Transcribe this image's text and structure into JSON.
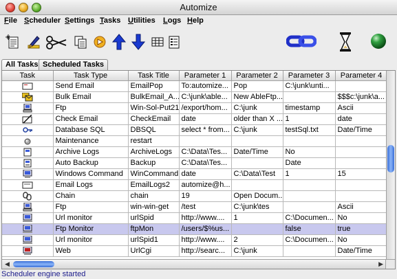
{
  "window": {
    "title": "Automize"
  },
  "menu": [
    {
      "label": "File",
      "u": "F",
      "rest": "ile"
    },
    {
      "label": "Scheduler",
      "u": "S",
      "rest": "cheduler"
    },
    {
      "label": "Settings",
      "u": "S",
      "rest": "ettings"
    },
    {
      "label": "Tasks",
      "u": "T",
      "rest": "asks"
    },
    {
      "label": "Utilities",
      "u": "U",
      "rest": "tilities"
    },
    {
      "label": "Logs",
      "u": "L",
      "rest": "ogs"
    },
    {
      "label": "Help",
      "u": "H",
      "rest": "elp"
    }
  ],
  "toolbar": [
    "new-task-icon",
    "edit-icon",
    "cut-icon",
    "copy-icon",
    "run-icon",
    "move-up-icon",
    "move-down-icon",
    "table-view-icon",
    "list-view-icon",
    "chain-link-icon",
    "hourglass-icon",
    "status-orb-icon"
  ],
  "tabs": [
    {
      "label": "All Tasks",
      "active": true
    },
    {
      "label": "Scheduled Tasks",
      "active": false
    }
  ],
  "table": {
    "columns": [
      "Task",
      "Task Type",
      "Task Title",
      "Parameter 1",
      "Parameter 2",
      "Parameter 3",
      "Parameter 4"
    ],
    "rows": [
      {
        "icon": "email-icon",
        "type": "Send Email",
        "title": "EmailPop",
        "p1": "To:automize...",
        "p2": "Pop",
        "p3": "C:\\junk\\unti...",
        "p4": ""
      },
      {
        "icon": "bulk-email-icon",
        "type": "Bulk Email",
        "title": "BulkEmail_A...",
        "p1": "C:\\junk\\able...",
        "p2": "New AbleFtp...",
        "p3": "",
        "p4": "$$$c:\\junk\\a..."
      },
      {
        "icon": "ftp-icon",
        "type": "Ftp",
        "title": "Win-Sol-Put21",
        "p1": "/export/hom...",
        "p2": "C:\\junk",
        "p3": "timestamp",
        "p4": "Ascii"
      },
      {
        "icon": "check-email-icon",
        "type": "Check Email",
        "title": "CheckEmail",
        "p1": "date",
        "p2": "older than X ...",
        "p3": "1",
        "p4": "date"
      },
      {
        "icon": "database-key-icon",
        "type": "Database SQL",
        "title": "DBSQL",
        "p1": "select * from...",
        "p2": "C:\\junk",
        "p3": "testSql.txt",
        "p4": "Date/Time"
      },
      {
        "icon": "maintenance-icon",
        "type": "Maintenance",
        "title": "restart",
        "p1": "",
        "p2": "",
        "p3": "",
        "p4": ""
      },
      {
        "icon": "archive-icon",
        "type": "Archive Logs",
        "title": "ArchiveLogs",
        "p1": "C:\\Data\\Tes...",
        "p2": "Date/Time",
        "p3": "No",
        "p4": ""
      },
      {
        "icon": "backup-icon",
        "type": "Auto Backup",
        "title": "Backup",
        "p1": "C:\\Data\\Tes...",
        "p2": "",
        "p3": "Date",
        "p4": ""
      },
      {
        "icon": "windows-command-icon",
        "type": "Windows Command",
        "title": "WinCommand",
        "p1": "date",
        "p2": "C:\\Data\\Test",
        "p3": "1",
        "p4": "15"
      },
      {
        "icon": "email-logs-icon",
        "type": "Email Logs",
        "title": "EmailLogs2",
        "p1": "automize@h...",
        "p2": "",
        "p3": "",
        "p4": ""
      },
      {
        "icon": "chain-icon",
        "type": "Chain",
        "title": "chain",
        "p1": "19",
        "p2": "Open Docum...",
        "p3": "",
        "p4": ""
      },
      {
        "icon": "ftp-icon",
        "type": "Ftp",
        "title": "win-win-get",
        "p1": "/test",
        "p2": "C:\\junk\\tes",
        "p3": "",
        "p4": "Ascii"
      },
      {
        "icon": "url-monitor-icon",
        "type": "Url monitor",
        "title": "urlSpid",
        "p1": "http://www....",
        "p2": "1",
        "p3": "C:\\Documen...",
        "p4": "No"
      },
      {
        "icon": "ftp-monitor-icon",
        "type": "Ftp Monitor",
        "title": "ftpMon",
        "p1": "/users/$%us...",
        "p2": "",
        "p3": "false",
        "p4": "true",
        "selected": true
      },
      {
        "icon": "url-monitor-icon",
        "type": "Url monitor",
        "title": "urlSpid1",
        "p1": "http://www....",
        "p2": "2",
        "p3": "C:\\Documen...",
        "p4": "No"
      },
      {
        "icon": "web-icon",
        "type": "Web",
        "title": "UrlCgi",
        "p1": "http://searc...",
        "p2": "C:\\junk",
        "p3": "",
        "p4": "Date/Time"
      }
    ]
  },
  "status": {
    "text": "Scheduler engine started"
  }
}
